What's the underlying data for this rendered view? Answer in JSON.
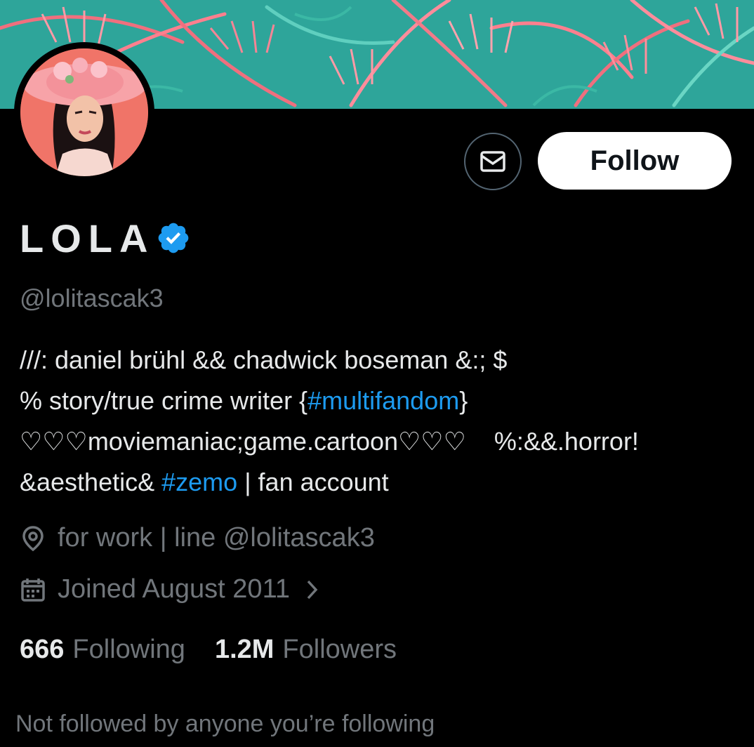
{
  "profile": {
    "display_name": "LOLA",
    "handle": "@lolitascak3",
    "verified": true
  },
  "actions": {
    "message_icon": "envelope-icon",
    "follow_label": "Follow"
  },
  "bio": {
    "line1": "///: daniel brühl && chadwick boseman &:; $",
    "line2_prefix": "% story/true crime writer {",
    "line2_hashtag": "#multifandom",
    "line2_suffix": "}",
    "line3": "♡♡♡moviemaniac;game.cartoon♡♡♡    %:&&.horror!",
    "line4_prefix": "&aesthetic& ",
    "line4_hashtag": "#zemo",
    "line4_suffix": " | fan account"
  },
  "meta": {
    "location": "for work | line @lolitascak3",
    "location_icon": "location-pin-icon",
    "joined": "Joined August 2011",
    "joined_icon": "calendar-icon"
  },
  "stats": {
    "following_count": "666",
    "following_label": "Following",
    "followers_count": "1.2M",
    "followers_label": "Followers"
  },
  "social_context": "Not followed by anyone you’re following",
  "colors": {
    "background": "#000000",
    "text_primary": "#e7e9ea",
    "text_secondary": "#71767b",
    "link": "#1d9bf0",
    "verified": "#1d9bf0"
  }
}
